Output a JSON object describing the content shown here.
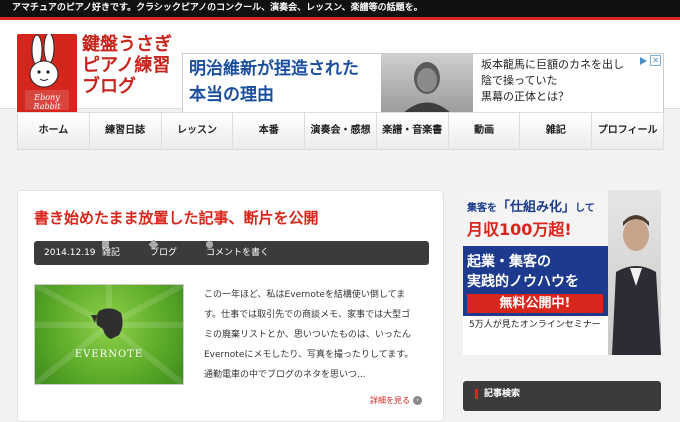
{
  "topbar": {
    "tagline": "アマチュアのピアノ好きです。クラシックピアノのコンクール、演奏会、レッスン、楽譜等の話題を。"
  },
  "site": {
    "logo_title_lines": [
      "鍵盤うさぎ",
      "ピアノ練習",
      "ブログ"
    ],
    "logo_badge_text": [
      "Ebony",
      "Rabbit"
    ]
  },
  "header_ad": {
    "left_lines": [
      "明治維新が捏造された",
      "本当の理由"
    ],
    "right_lines": [
      "坂本龍馬に巨額のカネを出し",
      "陰で操っていた",
      "黒幕の正体とは？"
    ]
  },
  "nav": {
    "items": [
      "ホーム",
      "練習日誌",
      "レッスン",
      "本番",
      "演奏会・感想",
      "楽譜・音楽書",
      "動画",
      "雑記",
      "プロフィール"
    ]
  },
  "post": {
    "title": "書き始めたまま放置した記事、断片を公開",
    "date": "2014.12.19",
    "category": "雑記",
    "tag": "ブログ",
    "comment_link": "コメントを書く",
    "thumbnail_label": "EVERNOTE",
    "excerpt_lines": [
      "この一年ほど、私はEvernoteを結構使い倒してま",
      "す。仕事では取引先での商談メモ、家事では大型ゴ",
      "ミの廃棄リストとか、思いついたものは、いったん",
      "Evernoteにメモしたり、写真を撮ったりしてます。",
      "通勤電車の中でブログのネタを思いつ..."
    ],
    "read_more": "詳細を見る"
  },
  "side_ad": {
    "line1_prefix": "集客を",
    "line1_highlight": "「仕組み化」",
    "line1_suffix": "して",
    "line2": "月収100万超!",
    "line3": "起業・集客の",
    "line4": "実践的ノウハウを",
    "line5": "無料公開中!",
    "line6": "5万人が見たオンラインセミナー"
  },
  "sidebar": {
    "widget_title": "記事検索"
  },
  "colors": {
    "accent": "#d8261c",
    "dark_bar": "#3b3b3b",
    "topbar": "#111111"
  }
}
